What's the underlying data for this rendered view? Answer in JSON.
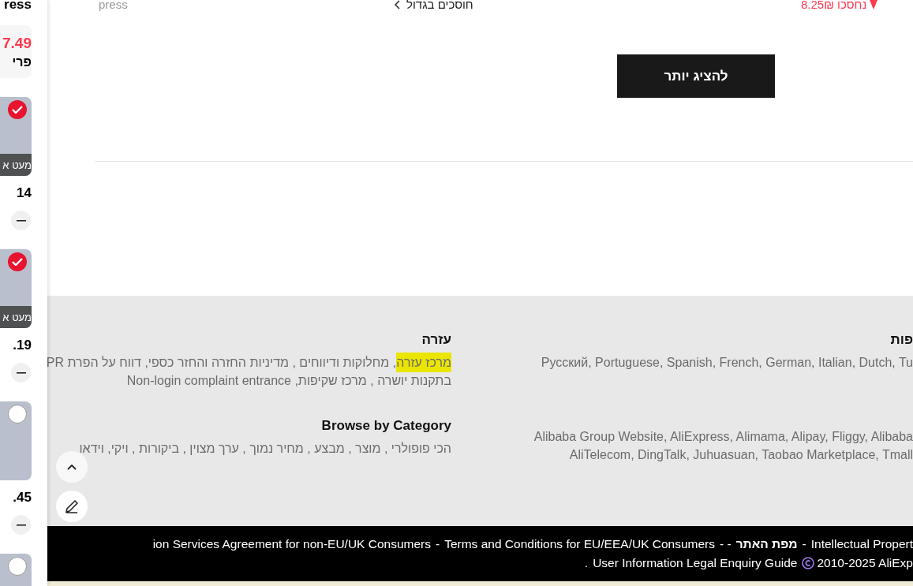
{
  "sidebar": {
    "title": "ress",
    "summary": {
      "price": "7.49",
      "label": "פרי"
    },
    "products": [
      {
        "selected": true,
        "overlay": "מעט א",
        "price": "14"
      },
      {
        "selected": true,
        "overlay": "מעט א",
        "price": ".19"
      },
      {
        "selected": false,
        "price": ".45"
      },
      {
        "selected": false
      }
    ]
  },
  "top_row": {
    "store": "press",
    "deal": "חוסכים בגדול",
    "saved": "נחסכו 8.25₪"
  },
  "show_more_button": "להציג יותר",
  "footer": {
    "columns": [
      {
        "title": "עזרה",
        "lines": [
          [
            {
              "text": "מרכז עזרה",
              "highlighted": true
            },
            {
              "text": ", מחלוקות ודיווחים , מדיניות החזרה והחזר כספי, דווח על הפרת PR",
              "highlighted": false
            }
          ],
          [
            {
              "text": "בתקנות יושרה , מרכז שקיפות, Non-login complaint entrance",
              "highlighted": false
            }
          ]
        ]
      },
      {
        "title": "Browse by Category",
        "lines": [
          [
            {
              "text": "הכי פופולרי , מוצר , מבצע , מחיר נמוך , ערך מצוין , ביקורות , ויקי, וידאו",
              "highlighted": false
            }
          ]
        ]
      }
    ],
    "side_columns": [
      {
        "title": "פות",
        "lines": [
          "Русский, Portuguese, Spanish, French, German, Italian, Dutch, Tu"
        ]
      },
      {
        "lines": [
          "Alibaba Group Website, AliExpress, Alimama, Alipay, Fliggy, Alibaba",
          "AliTelecom, DingTalk, Juhuasuan, Taobao Marketplace, Tmall"
        ]
      }
    ]
  },
  "bottom_bar": {
    "line_1": [
      {
        "kind": "link",
        "text": "Intellectual Propert"
      },
      {
        "kind": "sep",
        "text": "-"
      },
      {
        "kind": "bold",
        "text": "מפת האתר"
      },
      {
        "kind": "sep",
        "text": "- -"
      },
      {
        "kind": "link",
        "text": "Terms and Conditions for EU/EEA/UK Consumers"
      },
      {
        "kind": "sep",
        "text": "-"
      },
      {
        "kind": "link",
        "text": "ion Services Agreement for non-EU/UK Consumers"
      }
    ],
    "line_2": [
      {
        "kind": "copyright",
        "text": "2010-2025 AliExp"
      },
      {
        "kind": "link",
        "text": "User Information Legal Enquiry Guide"
      },
      {
        "kind": "sep",
        "text": "."
      }
    ]
  }
}
